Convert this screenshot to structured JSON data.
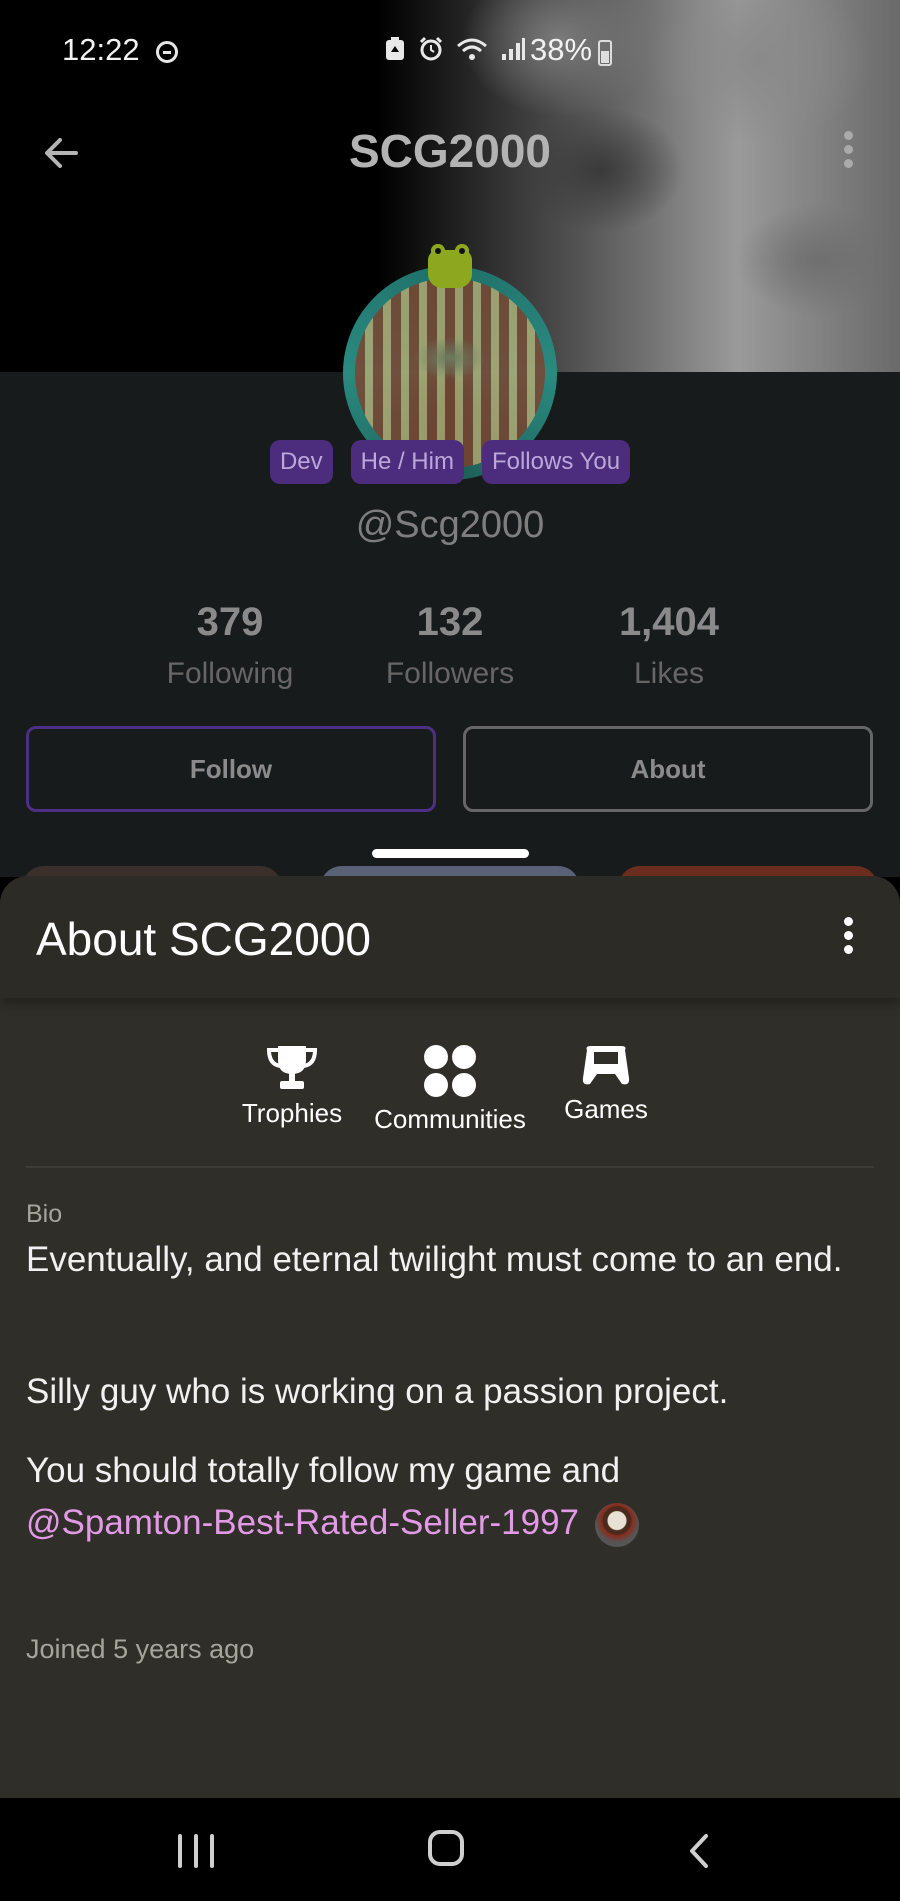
{
  "status_bar": {
    "time": "12:22",
    "battery": "38%",
    "icons": [
      "do-not-disturb-icon",
      "battery-saver-icon",
      "alarm-icon",
      "wifi-icon",
      "signal-icon",
      "battery-charging-icon"
    ]
  },
  "header": {
    "title": "SCG2000"
  },
  "profile": {
    "badges": [
      "Dev",
      "He / Him",
      "Follows You"
    ],
    "handle": "@Scg2000",
    "stats": [
      {
        "value": "379",
        "label": "Following"
      },
      {
        "value": "132",
        "label": "Followers"
      },
      {
        "value": "1,404",
        "label": "Likes"
      }
    ],
    "follow_label": "Follow",
    "about_label": "About"
  },
  "about_sheet": {
    "title": "About SCG2000",
    "tabs": [
      {
        "label": "Trophies",
        "icon": "trophy-icon"
      },
      {
        "label": "Communities",
        "icon": "communities-icon"
      },
      {
        "label": "Games",
        "icon": "gamepad-icon"
      }
    ],
    "bio_label": "Bio",
    "bio_line1": "Eventually, and eternal twilight must come to an end.",
    "bio_line2": "Silly guy who is working on a passion project.",
    "bio_line3_text": "You should totally follow my game and",
    "bio_mention": "@Spamton-Best-Rated-Seller-1997",
    "joined": "Joined 5 years ago"
  },
  "colors": {
    "accent_purple": "#4e2f86",
    "mention_pink": "#e39ae6",
    "sheet_bg": "#2f2e28"
  }
}
